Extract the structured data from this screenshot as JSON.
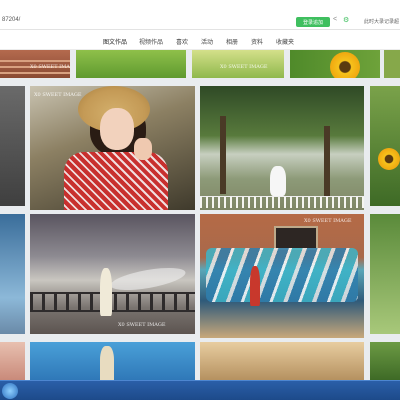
{
  "browser": {
    "url": "87204/",
    "login_button": "登录追加",
    "help_link": "此时大录记录超"
  },
  "tabs": [
    {
      "label": "图文作品",
      "active": true
    },
    {
      "label": "视频作品",
      "active": false
    },
    {
      "label": "喜欢",
      "active": false
    },
    {
      "label": "活动",
      "active": false
    },
    {
      "label": "相册",
      "active": false
    },
    {
      "label": "资料",
      "active": false
    },
    {
      "label": "收藏夹",
      "active": false
    }
  ],
  "gallery": {
    "watermark": "X0 SWEET IMAGE"
  }
}
